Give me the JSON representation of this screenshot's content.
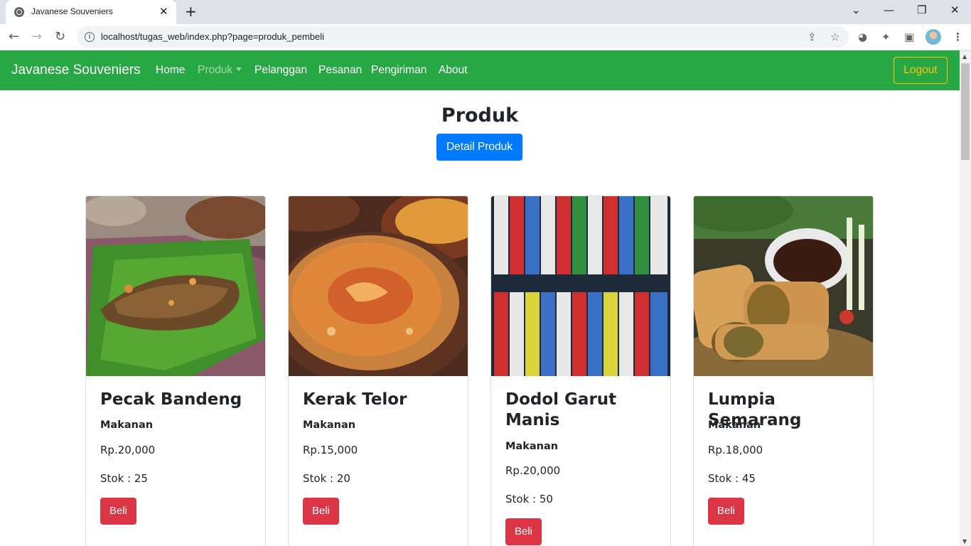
{
  "browser": {
    "tab_title": "Javanese Souveniers",
    "tab_close": "✕",
    "new_tab": "+",
    "url": "localhost/tugas_web/index.php?page=produk_pembeli",
    "window_controls": [
      "⌄",
      "—",
      "❐",
      "✕"
    ],
    "nav": {
      "back": "←",
      "forward": "→",
      "reload": "↻"
    }
  },
  "navbar": {
    "brand": "Javanese Souveniers",
    "links": [
      "Home",
      "Produk",
      "Pelanggan",
      "Pesanan",
      "Pengiriman",
      "About"
    ],
    "logout": "Logout",
    "bg_color": "#28a745"
  },
  "main": {
    "title": "Produk",
    "detail_button": "Detail Produk"
  },
  "products": [
    {
      "name": "Pecak Bandeng",
      "category": "Makanan",
      "price": "Rp.20,000",
      "stock": "Stok : 25",
      "buy": "Beli"
    },
    {
      "name": "Kerak Telor",
      "category": "Makanan",
      "price": "Rp.15,000",
      "stock": "Stok : 20",
      "buy": "Beli"
    },
    {
      "name": "Dodol Garut Manis",
      "category": "Makanan",
      "price": "Rp.20,000",
      "stock": "Stok : 50",
      "buy": "Beli"
    },
    {
      "name": "Lumpia Semarang",
      "category": "Makanan",
      "price": "Rp.18,000",
      "stock": "Stok : 45",
      "buy": "Beli"
    }
  ],
  "colors": {
    "buy_button": "#dc3545",
    "detail_button": "#007bff",
    "logout_border": "#ffc107"
  }
}
